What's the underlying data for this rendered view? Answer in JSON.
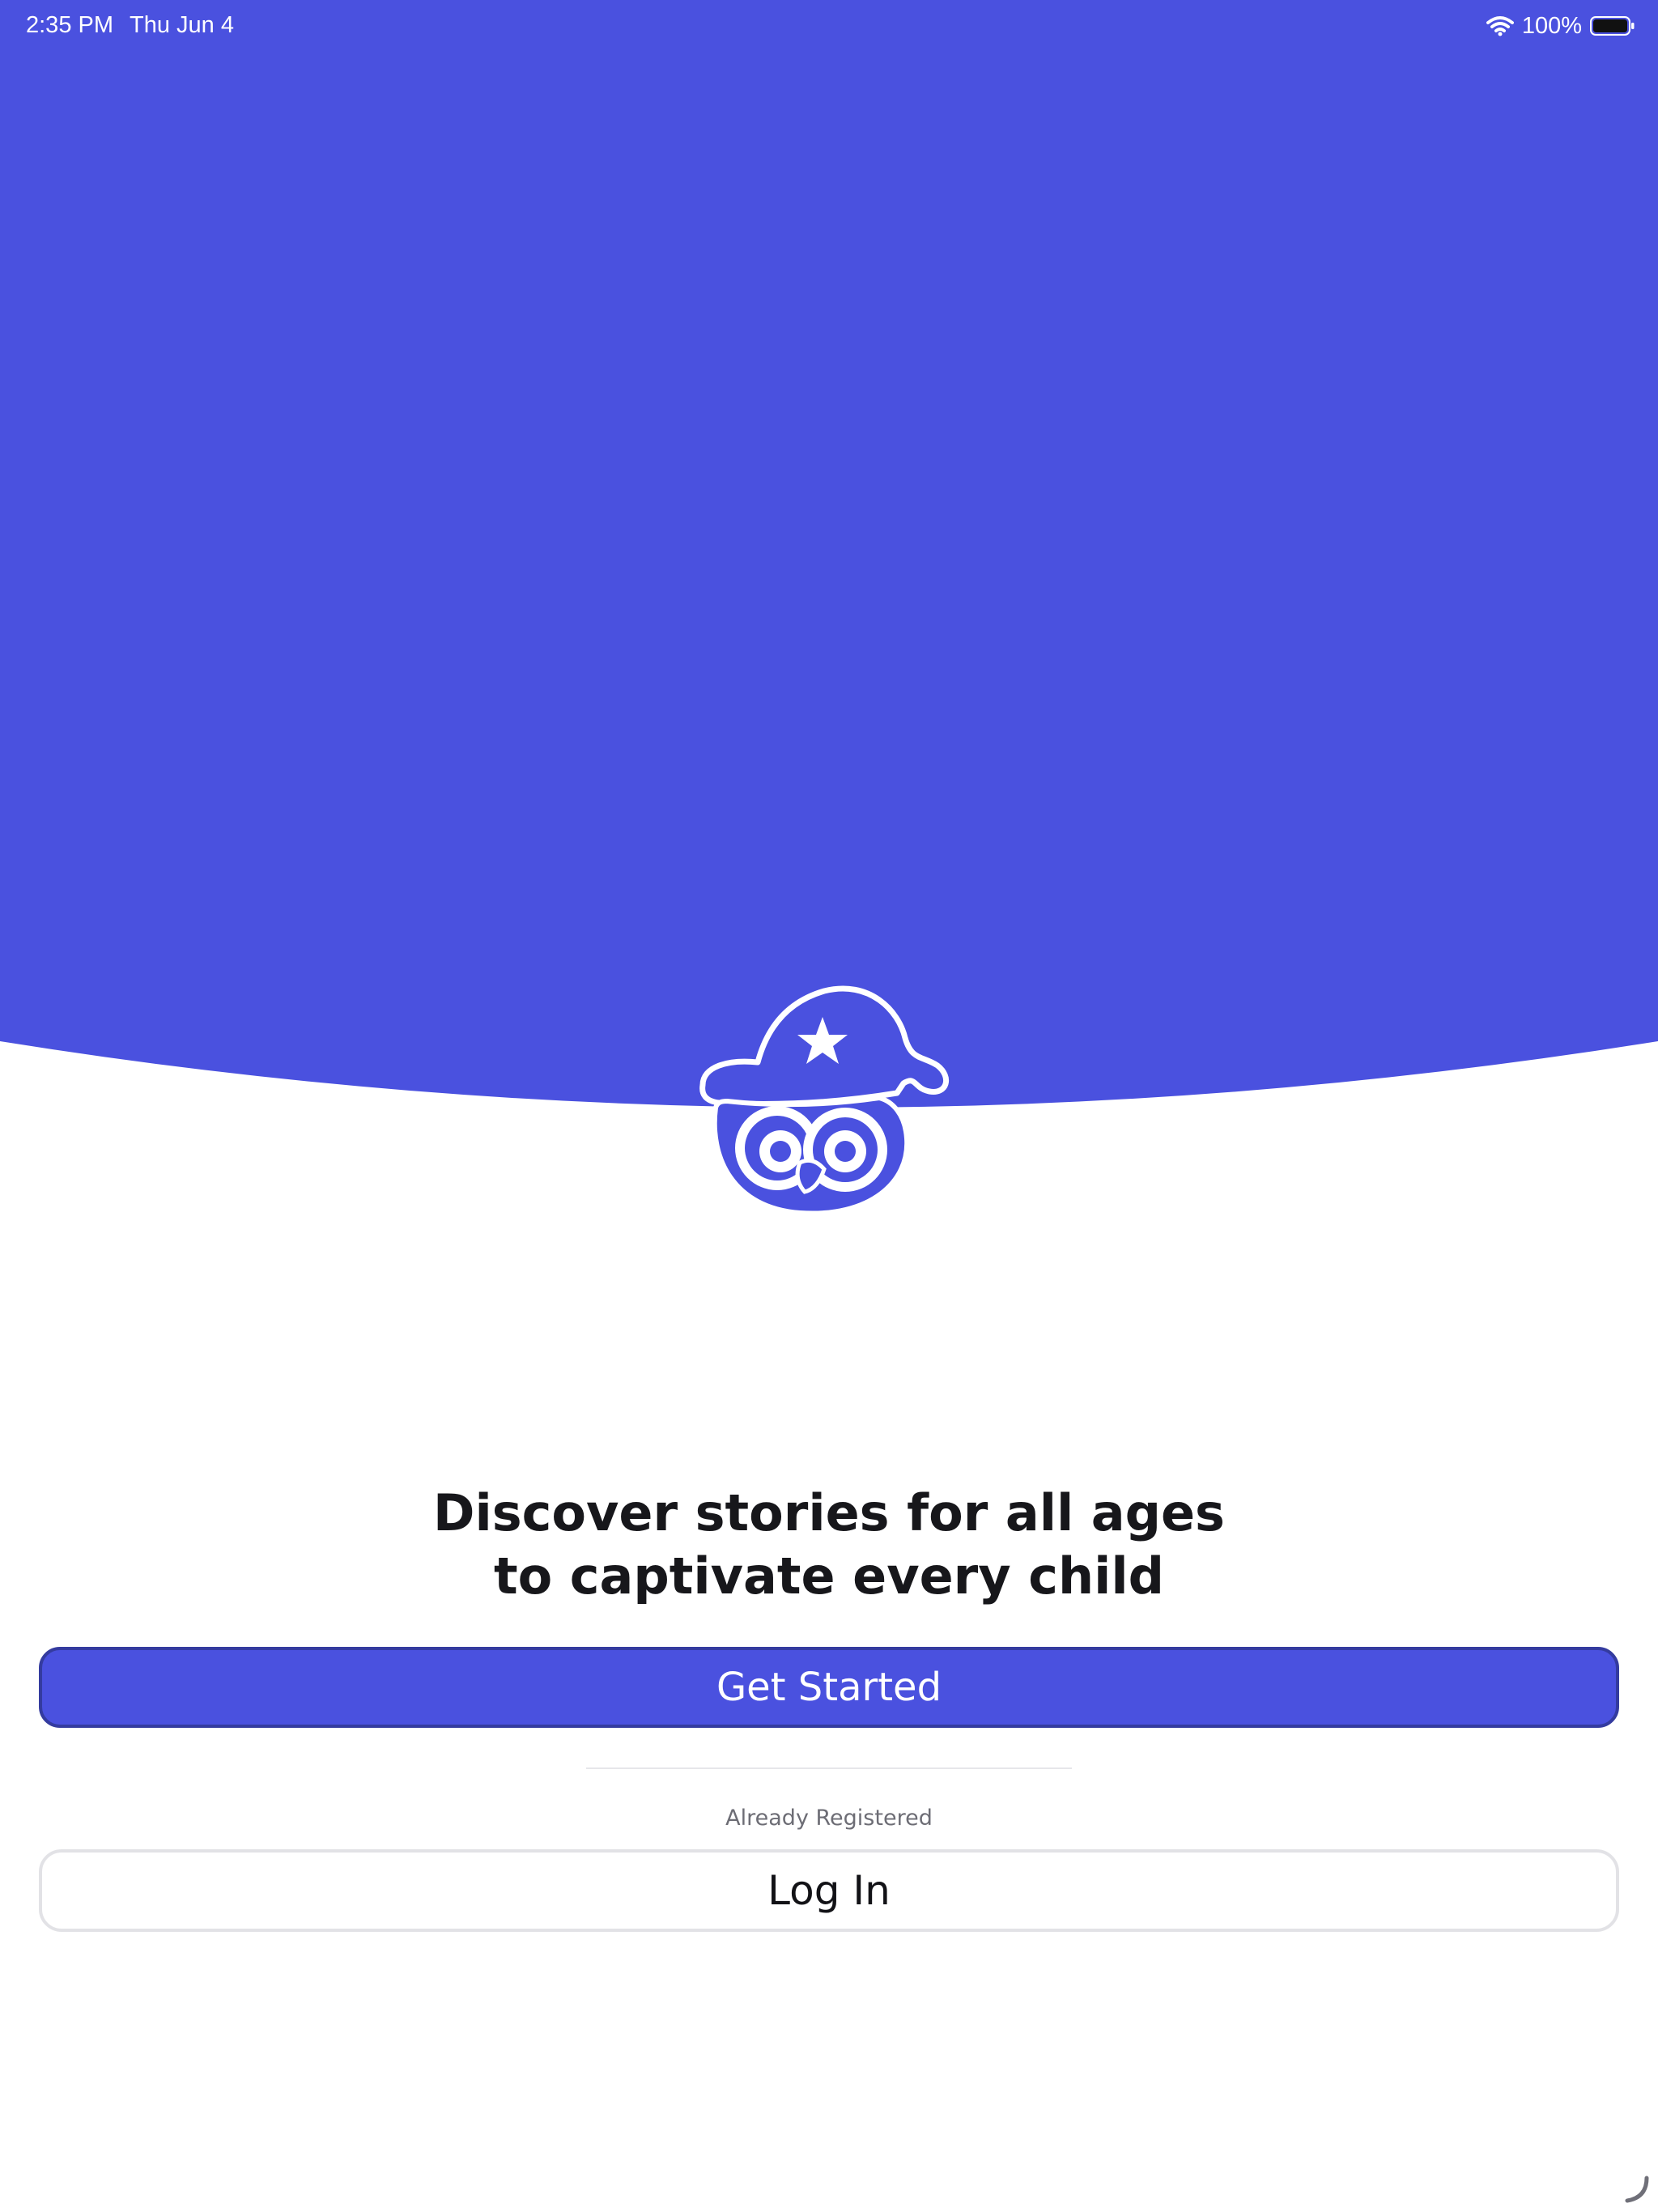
{
  "status_bar": {
    "time": "2:35 PM",
    "date": "Thu Jun 4",
    "battery_percent": "100%",
    "wifi_icon": "wifi-icon",
    "battery_icon": "battery-icon"
  },
  "colors": {
    "brand": "#4a51df",
    "brand_border": "#343b9f",
    "text_dark": "#17171b",
    "text_muted": "#6d6d75"
  },
  "logo": {
    "icon": "owl-wizard-logo-icon"
  },
  "headline": {
    "line1": "Discover stories for all ages",
    "line2": "to captivate every child"
  },
  "actions": {
    "get_started_label": "Get Started",
    "already_registered_label": "Already Registered",
    "login_label": "Log In"
  }
}
